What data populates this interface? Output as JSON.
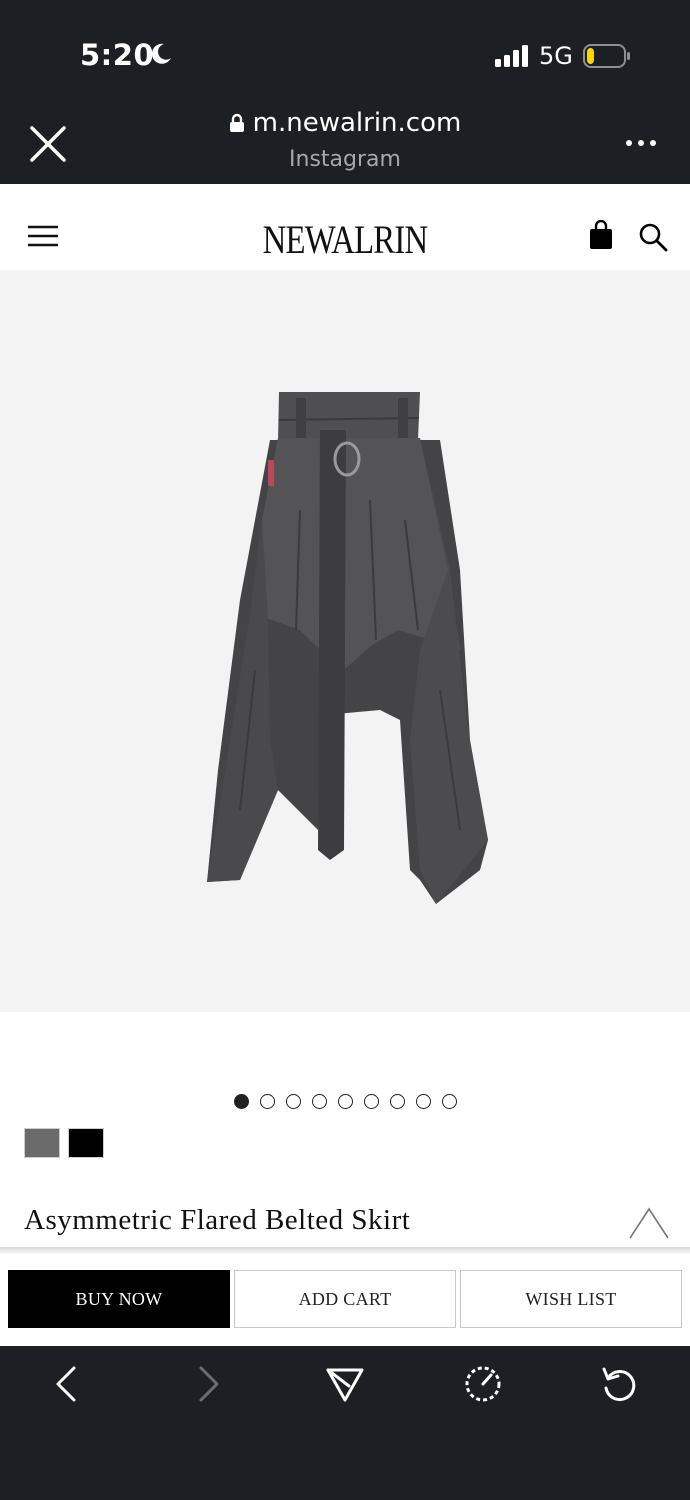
{
  "status_bar": {
    "time": "5:20",
    "network": "5G",
    "battery_level": 0.2,
    "battery_color": "#f5d60a"
  },
  "browser": {
    "url": "m.newalrin.com",
    "source": "Instagram"
  },
  "site": {
    "logo": "NEWALRIN"
  },
  "product": {
    "title": "Asymmetric Flared Belted Skirt",
    "image_count": 9,
    "active_image": 1,
    "swatches": [
      {
        "name": "gray",
        "color": "#6b6b6b"
      },
      {
        "name": "black",
        "color": "#000000"
      }
    ]
  },
  "actions": {
    "buy_now": "BUY NOW",
    "add_cart": "ADD CART",
    "wish_list": "WISH LIST"
  },
  "colors": {
    "chrome": "#1c1f24",
    "image_bg": "#f3f3f3",
    "skirt": "#4a4a4c"
  }
}
